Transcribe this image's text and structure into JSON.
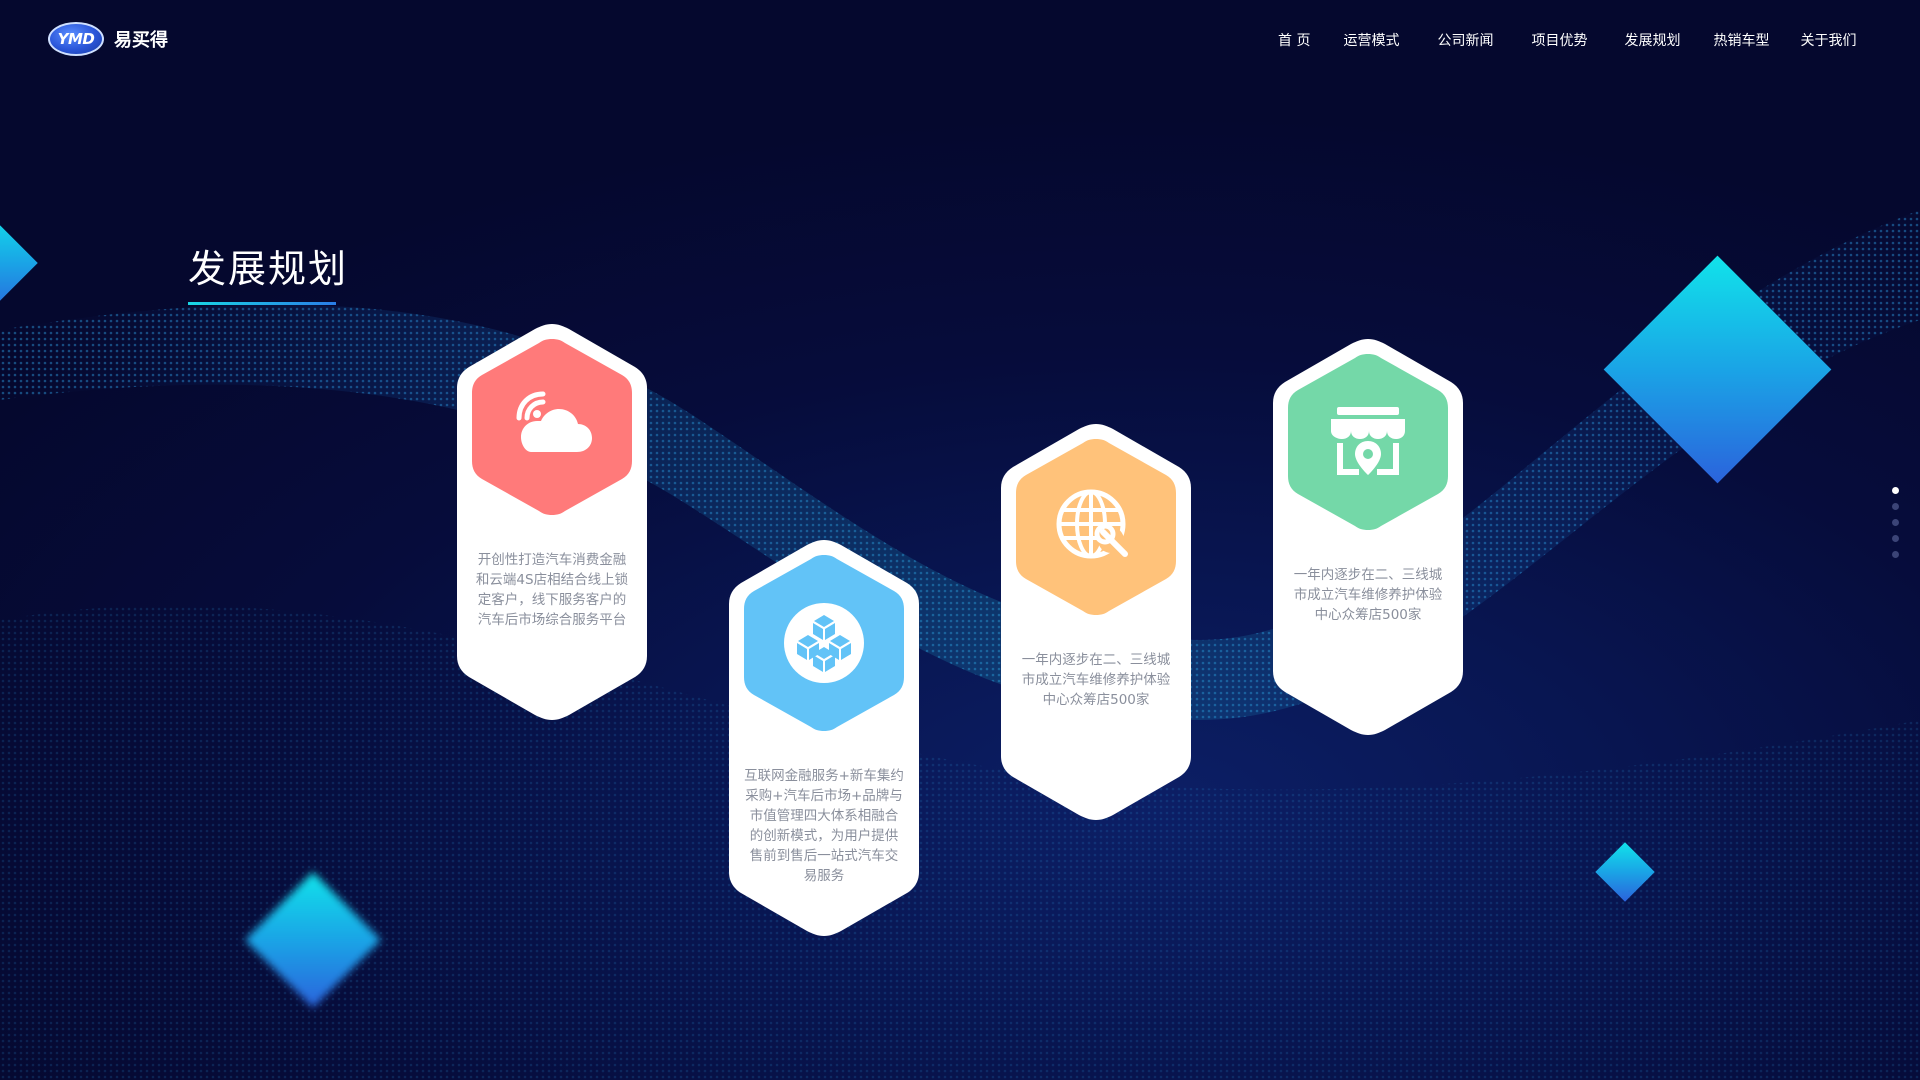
{
  "header": {
    "logo_badge": "YMD",
    "logo_text": "易买得",
    "nav": [
      {
        "label": "首 页"
      },
      {
        "label": "运营模式"
      },
      {
        "label": "公司新闻"
      },
      {
        "label": "项目优势"
      },
      {
        "label": "发展规划"
      },
      {
        "label": "热销车型"
      },
      {
        "label": "关于我们"
      }
    ]
  },
  "section": {
    "title": "发展规划"
  },
  "cards": [
    {
      "icon": "cloud-wifi-icon",
      "color": "#ff7a7a",
      "lines": [
        "开创性打造汽车消费金融",
        "和云端4S店相结合线上锁",
        "定客户，线下服务客户的",
        "汽车后市场综合服务平台"
      ]
    },
    {
      "icon": "cube-cluster-icon",
      "color": "#62c3f7",
      "lines": [
        "互联网金融服务+新车集约",
        "采购+汽车后市场+品牌与",
        "市值管理四大体系相融合",
        "的创新模式，为用户提供",
        "售前到售后一站式汽车交",
        "易服务"
      ]
    },
    {
      "icon": "globe-wrench-icon",
      "color": "#ffc27a",
      "lines": [
        "一年内逐步在二、三线城",
        "市成立汽车维修养护体验",
        "中心众筹店500家"
      ]
    },
    {
      "icon": "storefront-location-icon",
      "color": "#74d8a8",
      "lines": [
        "一年内逐步在二、三线城",
        "市成立汽车维修养护体验",
        "中心众筹店500家"
      ]
    }
  ],
  "pagination": {
    "count": 5,
    "active_index": 0
  },
  "colors": {
    "background": "#060c3b",
    "accent_cyan": "#19d7e5",
    "accent_blue": "#2b63dc"
  }
}
